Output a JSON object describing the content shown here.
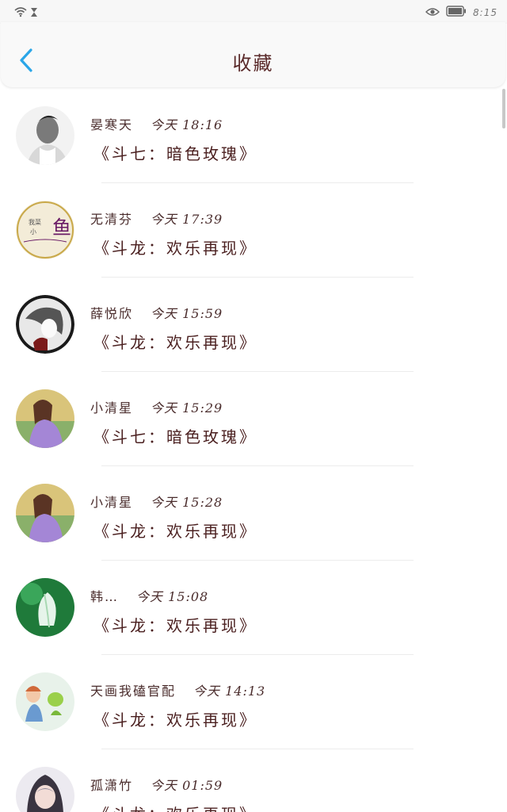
{
  "status_bar": {
    "time": "8:15",
    "icons": [
      "wifi-icon",
      "hourglass-icon",
      "eye-icon",
      "battery-icon"
    ]
  },
  "header": {
    "title": "收藏",
    "back_icon": "chevron-left-icon",
    "accent_color": "#2aa6e8"
  },
  "items": [
    {
      "name": "晏寒天",
      "time": "今天 18:16",
      "title": "《斗七：暗色玫瑰》",
      "avatar": "avatar-portrait-man"
    },
    {
      "name": "无清芬",
      "time": "今天 17:39",
      "title": "《斗龙：欢乐再现》",
      "avatar": "avatar-fish-calligraphy"
    },
    {
      "name": "薛悦欣",
      "time": "今天 15:59",
      "title": "《斗龙：欢乐再现》",
      "avatar": "avatar-anime-bw"
    },
    {
      "name": "小清星",
      "time": "今天 15:29",
      "title": "《斗七：暗色玫瑰》",
      "avatar": "avatar-girl-purple"
    },
    {
      "name": "小清星",
      "time": "今天 15:28",
      "title": "《斗龙：欢乐再现》",
      "avatar": "avatar-girl-purple"
    },
    {
      "name": "韩…",
      "time": "今天 15:08",
      "title": "《斗龙：欢乐再现》",
      "avatar": "avatar-green-flower"
    },
    {
      "name": "天画我磕官配",
      "time": "今天 14:13",
      "title": "《斗龙：欢乐再现》",
      "avatar": "avatar-anime-pair"
    },
    {
      "name": "孤潇竹",
      "time": "今天 01:59",
      "title": "《斗龙：欢乐再现》",
      "avatar": "avatar-anime-hood"
    }
  ]
}
